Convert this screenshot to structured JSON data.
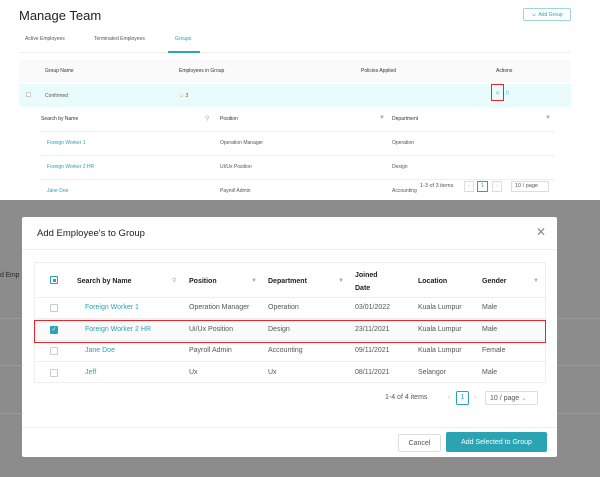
{
  "page": {
    "title": "Manage Team",
    "add_group": "Add Group",
    "tabs": [
      "Active Employees",
      "Terminated Employees",
      "Groups"
    ],
    "active_tab": "Groups"
  },
  "groups_table": {
    "headers": [
      "Group Name",
      "Employees in Group",
      "Policies Applied",
      "Actions"
    ],
    "row": {
      "name": "Confirmed",
      "count": "3"
    },
    "sub_headers": [
      "Search by Name",
      "Position",
      "Department"
    ],
    "sub_rows": [
      [
        "Foreign Worker 1",
        "Operation Manager",
        "Operation"
      ],
      [
        "Foreign Worker 2 HR",
        "UI/Ux Position",
        "Design"
      ],
      [
        "Jane Doe",
        "Payroll Admin",
        "Accounting"
      ]
    ],
    "pagination": {
      "summary": "1-3 of 3 items",
      "page": "1",
      "page_size": "10 / page"
    }
  },
  "background_fragment": "d Emp",
  "modal": {
    "title": "Add Employee's to Group",
    "headers": [
      "Search by Name",
      "Position",
      "Department",
      "Joined Date",
      "Location",
      "Gender"
    ],
    "rows": [
      {
        "checked": false,
        "name": "Foreign Worker 1",
        "position": "Operation Manager",
        "department": "Operation",
        "joined": "03/01/2022",
        "location": "Kuala Lumpur",
        "gender": "Male"
      },
      {
        "checked": true,
        "name": "Foreign Worker 2 HR",
        "position": "Ui/Ux Position",
        "department": "Design",
        "joined": "23/11/2021",
        "location": "Kuala Lumpur",
        "gender": "Male"
      },
      {
        "checked": false,
        "name": "Jane Doe",
        "position": "Payroll Admin",
        "department": "Accounting",
        "joined": "09/11/2021",
        "location": "Kuala Lumpur",
        "gender": "Female"
      },
      {
        "checked": false,
        "name": "Jeff",
        "position": "Ux",
        "department": "Ux",
        "joined": "08/11/2021",
        "location": "Selangor",
        "gender": "Male"
      }
    ],
    "pagination": {
      "summary": "1-4 of 4 items",
      "page": "1",
      "page_size": "10 / page"
    },
    "cancel": "Cancel",
    "submit": "Add Selected to Group"
  },
  "colors": {
    "accent": "#2aa3b3",
    "highlight": "#e8262b",
    "overlay": "#8c8c8c"
  }
}
